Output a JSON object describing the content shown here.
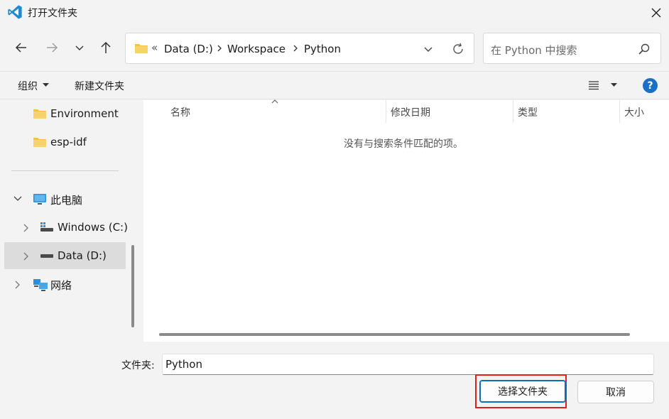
{
  "window": {
    "title": "打开文件夹",
    "app_icon": "vscode-icon",
    "close_icon": "close-icon"
  },
  "nav_buttons": {
    "back": "arrow-left-icon",
    "forward": "arrow-right-icon",
    "recent": "chevron-down-icon",
    "up": "arrow-up-icon"
  },
  "address": {
    "folder_icon": "folder-icon",
    "overflow": "«",
    "crumbs": [
      "Data (D:)",
      "Workspace",
      "Python"
    ]
  },
  "search": {
    "placeholder": "在 Python 中搜索"
  },
  "toolbar": {
    "organize_label": "组织",
    "new_folder_label": "新建文件夹"
  },
  "sidebar": {
    "items": [
      {
        "label": "Environment",
        "icon": "folder-icon"
      },
      {
        "label": "esp-idf",
        "icon": "folder-icon"
      },
      {
        "label": "此电脑",
        "icon": "computer-icon",
        "expanded": true
      },
      {
        "label": "Windows (C:)",
        "icon": "drive-icon"
      },
      {
        "label": "Data (D:)",
        "icon": "drive-icon",
        "selected": true
      },
      {
        "label": "网络",
        "icon": "network-icon"
      }
    ]
  },
  "file_list": {
    "columns": [
      "名称",
      "修改日期",
      "类型",
      "大小"
    ],
    "empty_message": "没有与搜索条件匹配的项。"
  },
  "footer": {
    "folder_label": "文件夹:",
    "folder_value": "Python",
    "select_button": "选择文件夹",
    "cancel_button": "取消"
  },
  "colors": {
    "accent": "#0f6cbd",
    "highlight": "#e02020",
    "folder": "#f5c242",
    "help": "#1a6fc9"
  }
}
